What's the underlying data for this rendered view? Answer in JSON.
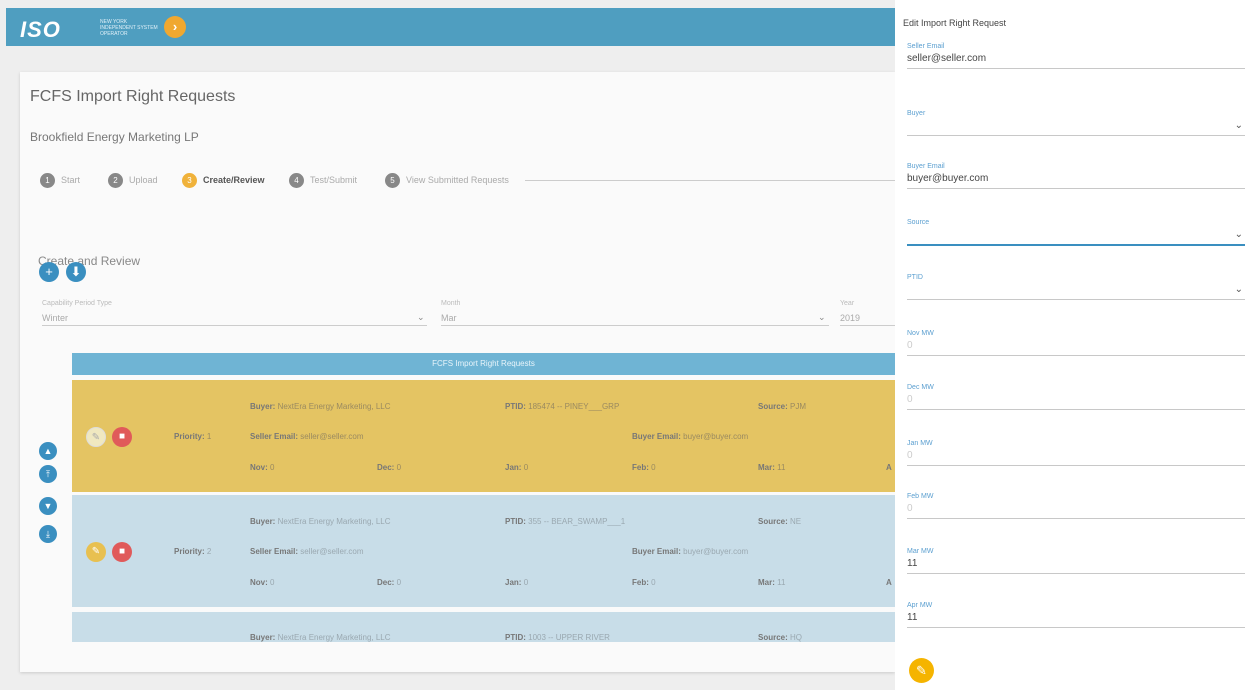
{
  "header": {
    "logo": "ISO",
    "logo_sub": "NEW YORK INDEPENDENT SYSTEM OPERATOR",
    "nav_arrow": "›"
  },
  "page": {
    "title": "FCFS Import Right Requests",
    "company": "Brookfield Energy Marketing LP",
    "section": "Create and Review"
  },
  "stepper": [
    {
      "num": "1",
      "label": "Start"
    },
    {
      "num": "2",
      "label": "Upload"
    },
    {
      "num": "3",
      "label": "Create/Review"
    },
    {
      "num": "4",
      "label": "Test/Submit"
    },
    {
      "num": "5",
      "label": "View Submitted Requests"
    }
  ],
  "actions": {
    "add": "+",
    "download": "⬇"
  },
  "filters": {
    "capability_label": "Capability Period Type",
    "capability_value": "Winter",
    "month_label": "Month",
    "month_value": "Mar",
    "year_label": "Year",
    "year_value": "2019"
  },
  "table": {
    "title": "FCFS Import Right Requests",
    "labels": {
      "buyer": "Buyer:",
      "ptid": "PTID:",
      "source": "Source:",
      "priority": "Priority:",
      "seller_email": "Seller Email:",
      "buyer_email": "Buyer Email:",
      "nov": "Nov:",
      "dec": "Dec:",
      "jan": "Jan:",
      "feb": "Feb:",
      "mar": "Mar:",
      "apr": "A"
    },
    "rows": [
      {
        "buyer": "NextEra Energy Marketing, LLC",
        "ptid": "185474 -- PINEY___GRP",
        "source": "PJM",
        "priority": "1",
        "seller_email": "seller@seller.com",
        "buyer_email": "buyer@buyer.com",
        "nov": "0",
        "dec": "0",
        "jan": "0",
        "feb": "0",
        "mar": "11"
      },
      {
        "buyer": "NextEra Energy Marketing, LLC",
        "ptid": "355 -- BEAR_SWAMP___1",
        "source": "NE",
        "priority": "2",
        "seller_email": "seller@seller.com",
        "buyer_email": "buyer@buyer.com",
        "nov": "0",
        "dec": "0",
        "jan": "0",
        "feb": "0",
        "mar": "11"
      },
      {
        "buyer": "NextEra Energy Marketing, LLC",
        "ptid": "1003 -- UPPER RIVER",
        "source": "HQ"
      }
    ]
  },
  "panel": {
    "title": "Edit Import Right Request",
    "fields": [
      {
        "label": "Seller Email",
        "value": "seller@seller.com"
      },
      {
        "label": "Buyer",
        "value": ""
      },
      {
        "label": "Buyer Email",
        "value": "buyer@buyer.com"
      },
      {
        "label": "Source",
        "value": ""
      },
      {
        "label": "PTID",
        "value": ""
      },
      {
        "label": "Nov MW",
        "value": "0"
      },
      {
        "label": "Dec MW",
        "value": "0"
      },
      {
        "label": "Jan MW",
        "value": "0"
      },
      {
        "label": "Feb MW",
        "value": "0"
      },
      {
        "label": "Mar MW",
        "value": "11"
      },
      {
        "label": "Apr MW",
        "value": "11"
      }
    ],
    "chevron": "⌄"
  },
  "colors": {
    "accent_blue": "#3a8fc0",
    "header_blue": "#4f9ec0",
    "accent_yellow": "#f5b400",
    "delete_red": "#e05a5a"
  }
}
